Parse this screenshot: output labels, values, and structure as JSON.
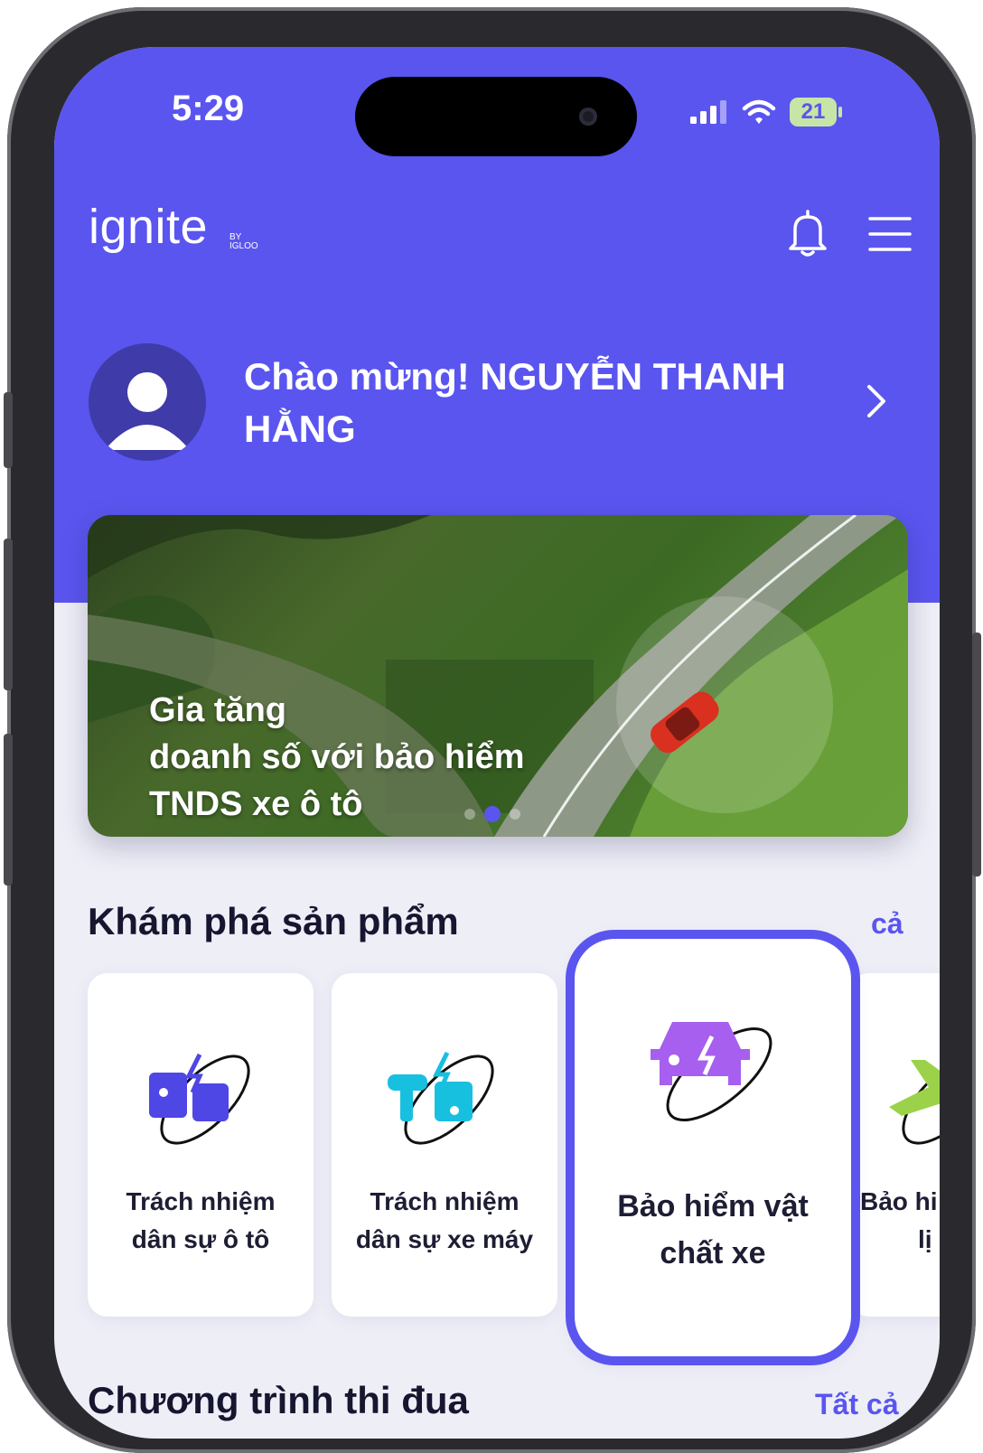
{
  "status_bar": {
    "time": "5:29",
    "battery": "21"
  },
  "header": {
    "logo": "ignite",
    "logo_sub_line1": "BY",
    "logo_sub_line2": "IGLOO"
  },
  "profile": {
    "greeting": "Chào mừng! NGUYỄN THANH HẰNG"
  },
  "banner": {
    "line1": "Gia tăng",
    "line2": "doanh số với bảo hiểm",
    "line3": "TNDS xe ô tô",
    "active_slide": 2,
    "slide_count": 3
  },
  "products": {
    "title": "Khám phá sản phẩm",
    "see_all": "cả",
    "items": [
      {
        "label_line1": "Trách nhiệm",
        "label_line2": "dân sự ô tô",
        "icon": "car-liability-icon"
      },
      {
        "label_line1": "Trách nhiệm",
        "label_line2": "dân sự xe máy",
        "icon": "motorbike-liability-icon"
      },
      {
        "label_line1": "Bảo hiểm vật",
        "label_line2": "chất xe",
        "icon": "car-damage-icon"
      },
      {
        "label_line1": "Bảo hi",
        "label_line2": "lị",
        "icon": "travel-plane-icon"
      }
    ]
  },
  "competition": {
    "title": "Chương trình thi đua",
    "see_all": "Tất cả"
  },
  "colors": {
    "brand": "#5a55ef",
    "background": "#eeeef7",
    "accent_green": "#9bd24a"
  }
}
